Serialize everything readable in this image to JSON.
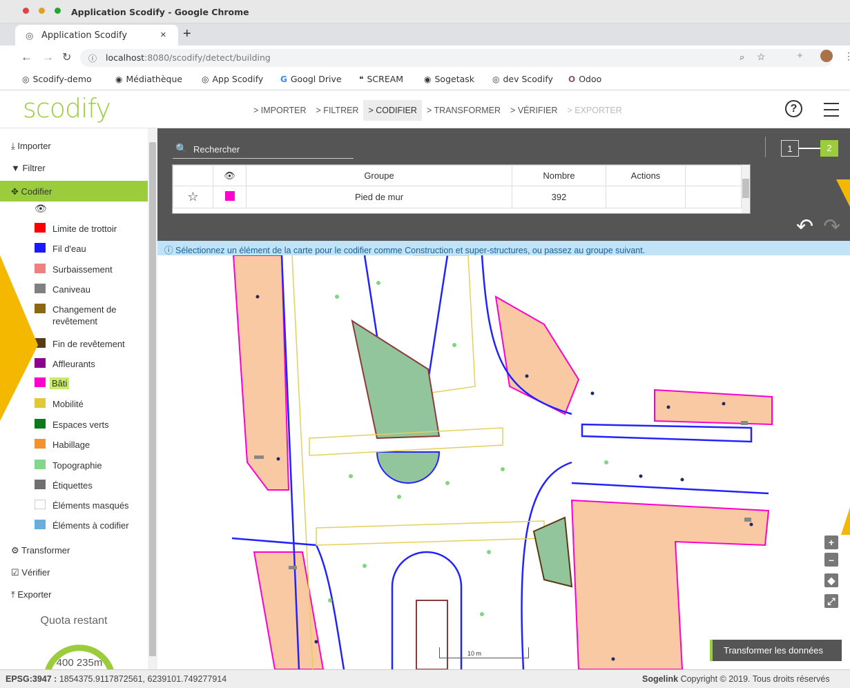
{
  "browser": {
    "window_title": "Application Scodify - Google Chrome",
    "tab_title": "Application Scodify",
    "url_host": "localhost",
    "url_path": ":8080/scodify/detect/building",
    "bookmarks": [
      "Scodify-demo",
      "Médiathèque",
      "App Scodify",
      "Googl Drive",
      "SCREAM",
      "Sogetask",
      "dev Scodify",
      "Odoo"
    ]
  },
  "app": {
    "logo": "scodify",
    "steps": [
      "> IMPORTER",
      "> FILTRER",
      "> CODIFIER",
      "> TRANSFORMER",
      "> VÉRIFIER",
      "> EXPORTER"
    ],
    "active_step": "> CODIFIER"
  },
  "sidebar": {
    "importer": "Importer",
    "filtrer": "Filtrer",
    "codifier": "Codifier",
    "transformer": "Transformer",
    "verifier": "Vérifier",
    "exporter": "Exporter",
    "legend": [
      {
        "label": "Limite de trottoir",
        "color": "#ff0000"
      },
      {
        "label": "Fil d'eau",
        "color": "#1a1aff"
      },
      {
        "label": "Surbaissement",
        "color": "#f08080"
      },
      {
        "label": "Caniveau",
        "color": "#808080"
      },
      {
        "label": "Changement de revêtement",
        "color": "#8b6914"
      },
      {
        "label": "Fin de revêtement",
        "color": "#5a3a12"
      },
      {
        "label": "Affleurants",
        "color": "#8b008b"
      },
      {
        "label": "Bâti",
        "color": "#ff00cc"
      },
      {
        "label": "Mobilité",
        "color": "#e0c837"
      },
      {
        "label": "Espaces verts",
        "color": "#0a7a1a"
      },
      {
        "label": "Habillage",
        "color": "#f39230"
      },
      {
        "label": "Topographie",
        "color": "#85d68a"
      },
      {
        "label": "Étiquettes",
        "color": "#707070"
      },
      {
        "label": "Éléments masqués",
        "color": "#ffffff"
      },
      {
        "label": "Éléments à codifier",
        "color": "#6aaee0"
      }
    ],
    "quota_label": "Quota restant",
    "quota_value": "400 235m"
  },
  "panel": {
    "search_placeholder": "Rechercher",
    "table": {
      "headers": [
        "",
        "",
        "Groupe",
        "Nombre",
        "Actions"
      ],
      "rows": [
        {
          "groupe": "Pied de mur",
          "nombre": "392",
          "color": "#ff00cc"
        }
      ]
    },
    "page_steps": [
      "1",
      "2"
    ]
  },
  "info_message": "Sélectionnez un élément de la carte pour le codifier comme Construction et super-structures, ou passez au groupe suivant.",
  "map": {
    "scale_label": "10 m",
    "transform_button": "Transformer les données"
  },
  "status": {
    "epsg_label": "EPSG:3947 :",
    "coords": "1854375.9117872561, 6239101.749277914",
    "company": "Sogelink",
    "copyright": "Copyright © 2019. Tous droits réservés"
  }
}
